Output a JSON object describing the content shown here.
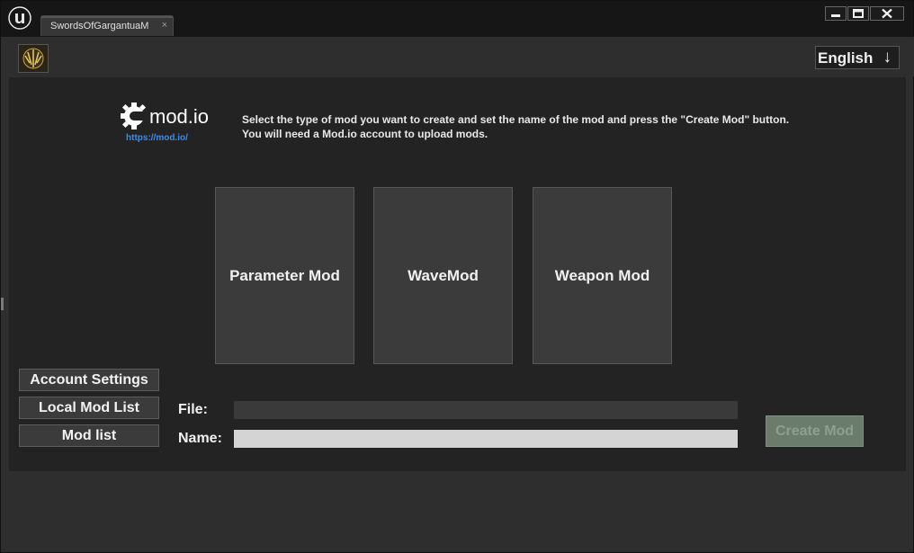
{
  "titlebar": {
    "tab_label": "SwordsOfGargantuaM",
    "tab_close": "×"
  },
  "header": {
    "language": {
      "selected": "English",
      "arrow": "↓"
    }
  },
  "brand": {
    "logo_text": "mod.io",
    "link": "https://mod.io/"
  },
  "instructions": {
    "line1": "Select the type of mod you want to create and set the name of the mod and press the \"Create Mod\" button.",
    "line2": "You will need a Mod.io account to upload mods."
  },
  "mod_types": [
    {
      "label": "Parameter Mod"
    },
    {
      "label": "WaveMod"
    },
    {
      "label": "Weapon Mod"
    }
  ],
  "sidebar": {
    "account_settings": "Account Settings",
    "local_mod_list": "Local Mod List",
    "mod_list": "Mod list"
  },
  "form": {
    "file_label": "File:",
    "file_value": "",
    "name_label": "Name:",
    "name_value": "",
    "create_button": "Create Mod"
  },
  "colors": {
    "panel_bg": "#232323",
    "card_bg": "#3b3b3b",
    "link": "#2e8fff",
    "create_button_disabled": "#6a7d6c"
  },
  "icons": {
    "engine_logo": "unreal-engine-icon",
    "app_icon": "game-emblem-icon",
    "logo_gear": "gear-icon"
  }
}
